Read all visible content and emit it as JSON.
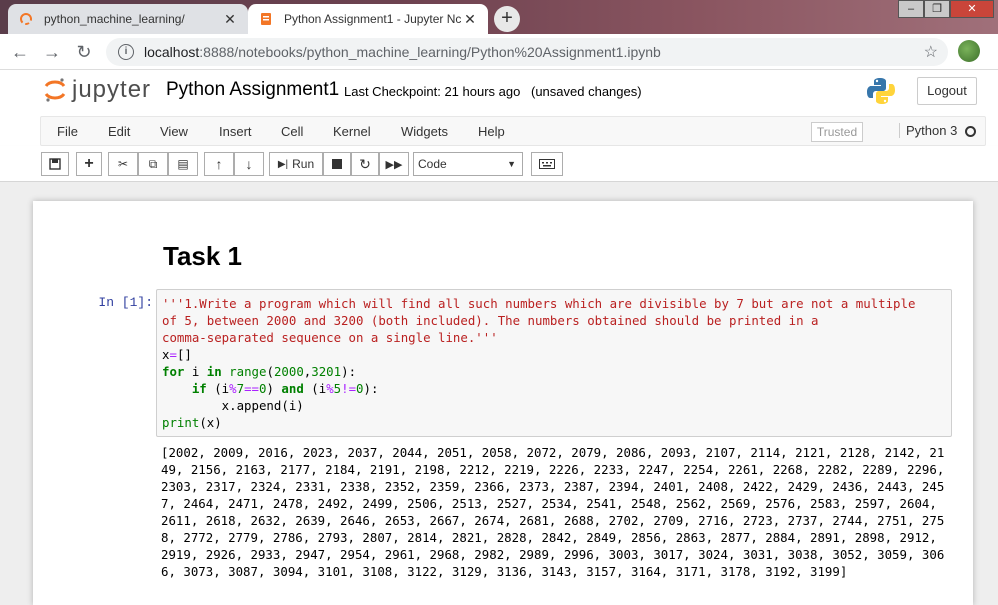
{
  "browser": {
    "tabs": [
      {
        "title": "python_machine_learning/",
        "active": false
      },
      {
        "title": "Python Assignment1 - Jupyter Nc",
        "active": true
      }
    ],
    "url_host": "localhost",
    "url_path": ":8888/notebooks/python_machine_learning/Python%20Assignment1.ipynb"
  },
  "jupyter": {
    "logo_text": "jupyter",
    "notebook_name": "Python Assignment1",
    "checkpoint": "Last Checkpoint: 21 hours ago",
    "unsaved": "(unsaved changes)",
    "logout": "Logout"
  },
  "menu": {
    "items": [
      "File",
      "Edit",
      "View",
      "Insert",
      "Cell",
      "Kernel",
      "Widgets",
      "Help"
    ],
    "trusted": "Trusted",
    "kernel_name": "Python 3"
  },
  "toolbar": {
    "run_label": "Run",
    "cell_type": "Code"
  },
  "notebook": {
    "heading": "Task 1",
    "prompt": "In [1]:",
    "code_lines": [
      "'''1.Write a program which will find all such numbers which are divisible by 7 but are not a multiple",
      "of 5, between 2000 and 3200 (both included). The numbers obtained should be printed in a",
      "comma-separated sequence on a single line.'''",
      "x=[]",
      "for i in range(2000,3201):",
      "    if (i%7==0) and (i%5!=0):",
      "        x.append(i)",
      "print(x)"
    ],
    "output": "[2002, 2009, 2016, 2023, 2037, 2044, 2051, 2058, 2072, 2079, 2086, 2093, 2107, 2114, 2121, 2128, 2142, 2149, 2156, 2163, 2177, 2184, 2191, 2198, 2212, 2219, 2226, 2233, 2247, 2254, 2261, 2268, 2282, 2289, 2296, 2303, 2317, 2324, 2331, 2338, 2352, 2359, 2366, 2373, 2387, 2394, 2401, 2408, 2422, 2429, 2436, 2443, 2457, 2464, 2471, 2478, 2492, 2499, 2506, 2513, 2527, 2534, 2541, 2548, 2562, 2569, 2576, 2583, 2597, 2604, 2611, 2618, 2632, 2639, 2646, 2653, 2667, 2674, 2681, 2688, 2702, 2709, 2716, 2723, 2737, 2744, 2751, 2758, 2772, 2779, 2786, 2793, 2807, 2814, 2821, 2828, 2842, 2849, 2856, 2863, 2877, 2884, 2891, 2898, 2912, 2919, 2926, 2933, 2947, 2954, 2961, 2968, 2982, 2989, 2996, 3003, 3017, 3024, 3031, 3038, 3052, 3059, 3066, 3073, 3087, 3094, 3101, 3108, 3122, 3129, 3136, 3143, 3157, 3164, 3171, 3178, 3192, 3199]"
  }
}
